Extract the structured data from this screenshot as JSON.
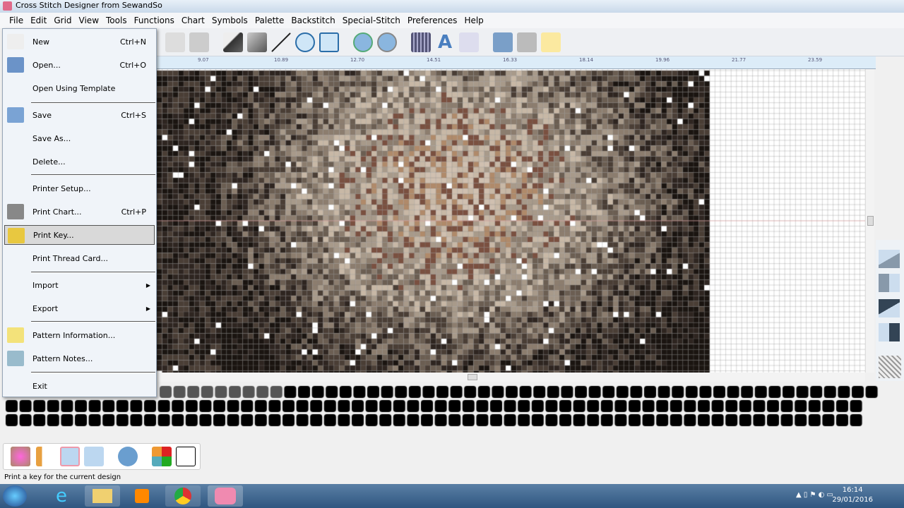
{
  "window": {
    "title": "Cross Stitch Designer from SewandSo"
  },
  "menubar": [
    "File",
    "Edit",
    "Grid",
    "View",
    "Tools",
    "Functions",
    "Chart",
    "Symbols",
    "Palette",
    "Backstitch",
    "Special-Stitch",
    "Preferences",
    "Help"
  ],
  "ruler": [
    "9.07",
    "10.89",
    "12.70",
    "14.51",
    "16.33",
    "18.14",
    "19.96",
    "21.77",
    "23.59"
  ],
  "file_menu": [
    {
      "label": "New",
      "shortcut": "Ctrl+N",
      "icon": "new-file-icon"
    },
    {
      "label": "Open...",
      "shortcut": "Ctrl+O",
      "icon": "folder-icon"
    },
    {
      "label": "Open Using Template",
      "shortcut": ""
    },
    {
      "label": "Save",
      "shortcut": "Ctrl+S",
      "icon": "save-icon"
    },
    {
      "label": "Save As...",
      "shortcut": ""
    },
    {
      "label": "Delete...",
      "shortcut": ""
    },
    {
      "label": "Printer Setup...",
      "shortcut": ""
    },
    {
      "label": "Print Chart...",
      "shortcut": "Ctrl+P",
      "icon": "printer-icon"
    },
    {
      "label": "Print Key...",
      "shortcut": "",
      "icon": "print-key-icon",
      "highlighted": true
    },
    {
      "label": "Print Thread Card...",
      "shortcut": ""
    },
    {
      "label": "Import",
      "submenu": true
    },
    {
      "label": "Export",
      "submenu": true
    },
    {
      "label": "Pattern Information...",
      "icon": "info-icon"
    },
    {
      "label": "Pattern Notes...",
      "icon": "notes-icon"
    },
    {
      "label": "Exit"
    }
  ],
  "status": {
    "text": "Print a key for the current design"
  },
  "clock": {
    "time": "16:14",
    "date": "29/01/2016"
  },
  "colors": {
    "accent": "#3399dd",
    "menu_bg": "#f0f4f9"
  }
}
